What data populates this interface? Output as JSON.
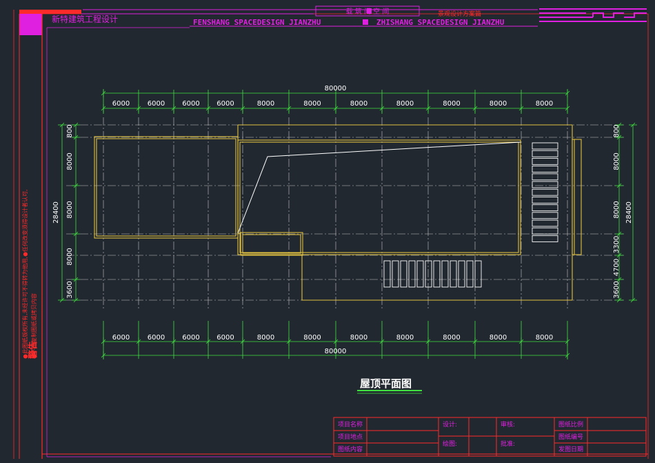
{
  "header": {
    "company_cn": "新特建筑工程设计",
    "brand_box": "载 筑 间 空 间",
    "subtitle_cn": "景观设计方案篇",
    "english_banner_left": "FENSHANG   SPACEDESIGN JIANZHU",
    "english_banner_right": "ZHISHANG   SPACEDESIGN JIANZHU"
  },
  "warning": {
    "title": "警告",
    "line1": "●此图纸版权所有,未经许可不得转为他用,●任何改变须得设计者认可,",
    "line2": "●不得复制图纸或拷贝内容"
  },
  "drawing": {
    "title": "屋顶平面图",
    "top_total": "80000",
    "bottom_total": "80000",
    "top_spans": [
      "6000",
      "6000",
      "6000",
      "6000",
      "8000",
      "8000",
      "8000",
      "8000",
      "8000",
      "8000",
      "8000"
    ],
    "bottom_spans": [
      "6000",
      "6000",
      "6000",
      "6000",
      "8000",
      "8000",
      "8000",
      "8000",
      "8000",
      "8000",
      "8000"
    ],
    "left_total": "28400",
    "right_total": "28400",
    "left_spans": [
      "800",
      "8000",
      "8000",
      "8000",
      "3600"
    ],
    "right_spans": [
      "800",
      "8000",
      "8000",
      "3300",
      "4700",
      "3600"
    ]
  },
  "title_block": {
    "project_name": "项目名称",
    "project_site": "项目地点",
    "drawing_content": "图纸内容",
    "design": "设计:",
    "draw": "绘图:",
    "review": "审核:",
    "approve": "批准:",
    "scale": "图纸比例",
    "number": "图纸编号",
    "date": "发图日期"
  },
  "colors": {
    "background": "#212830",
    "frame_red": "#ff2a2a",
    "magenta": "#e020e0",
    "building_yellow": "#e0c040",
    "grid_white": "#c8c8c8",
    "dim_green": "#40e040"
  }
}
